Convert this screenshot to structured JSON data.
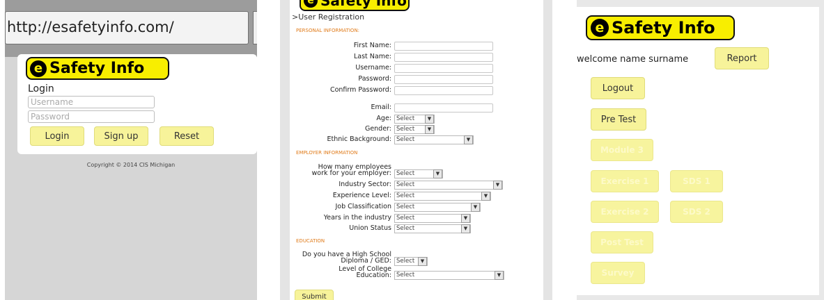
{
  "login_screen": {
    "url": "http://esafetyinfo.com/",
    "logo": {
      "mark": "e",
      "text": "Safety Info"
    },
    "title": "Login",
    "username_placeholder": "Username",
    "password_placeholder": "Password",
    "buttons": {
      "login": "Login",
      "signup": "Sign up",
      "reset": "Reset"
    },
    "copyright": "Copyright © 2014 CIS Michigan"
  },
  "registration_screen": {
    "logo": {
      "mark": "e",
      "text": "Safety Info"
    },
    "breadcrumb": ">User Registration",
    "sections": {
      "personal": "PERSONAL INFORMATION:",
      "employer": "EMPLOYER INFORMATION",
      "education": "EDUCATION"
    },
    "personal_fields": {
      "first_name": "First Name:",
      "last_name": "Last Name:",
      "username": "Username:",
      "password": "Password:",
      "confirm_password": "Confirm Password:",
      "email": "Email:",
      "age": "Age:",
      "gender": "Gender:",
      "ethnic_background": "Ethnic Background:"
    },
    "employer_fields": {
      "employees_line1": "How many employees",
      "employees_line2": "work for your employer:",
      "industry_sector": "Industry Sector:",
      "experience_level": "Experience Level:",
      "job_classification": "Job Classification",
      "years_in_industry": "Years in the industry",
      "union_status": "Union Status"
    },
    "education_fields": {
      "diploma_line1": "Do you have a High School",
      "diploma_line2": "Diploma / GED:",
      "college_line1": "Level of College",
      "college_line2": "Education:"
    },
    "select_value": "Select",
    "submit_label": "Submit"
  },
  "menu_screen": {
    "logo": {
      "mark": "e",
      "text": "Safety Info"
    },
    "welcome": "welcome name surname",
    "report": "Report",
    "logout": "Logout",
    "pre_test": "Pre Test",
    "module_3": "Module 3",
    "exercise_1": "Exercise 1",
    "sds_1": "SDS 1",
    "exercise_2": "Exercise 2",
    "sds_2": "SDS 2",
    "post_test": "Post Test",
    "survey": "Survey"
  },
  "colors": {
    "logo_yellow": "#f8ee00",
    "button_yellow": "#f7f39a",
    "section_orange": "#e07b1a"
  }
}
